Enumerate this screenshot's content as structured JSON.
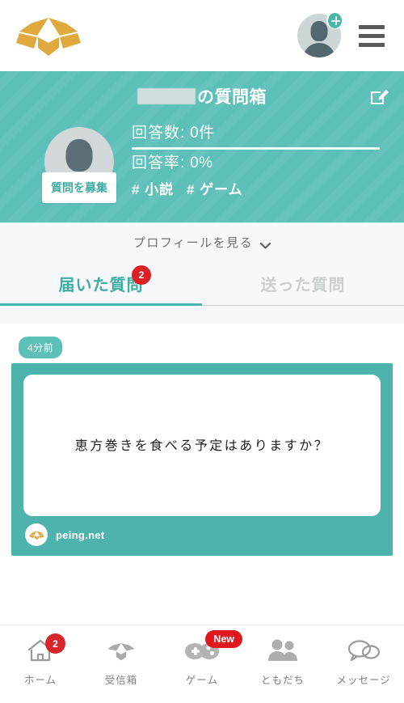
{
  "header": {
    "logo_icon": "open-box-logo",
    "avatar_icon": "user-avatar",
    "avatar_badge_icon": "plus-badge-icon",
    "menu_icon": "hamburger-menu-icon",
    "brand_color": "#e0a93e"
  },
  "banner": {
    "title_redacted": "",
    "title_suffix": "の質問箱",
    "edit_icon": "compose-edit-icon",
    "profile_avatar_icon": "profile-avatar",
    "collect_button_label": "質問を募集",
    "answer_count_label": "回答数:",
    "answer_count_value": "0件",
    "answer_rate_label": "回答率:",
    "answer_rate_value": "0%",
    "tags": [
      "# 小説",
      "# ゲーム"
    ],
    "background_color": "#5cbfb8"
  },
  "profile_link": {
    "label": "プロフィールを見る",
    "chevron_icon": "chevron-down-icon"
  },
  "tabs": [
    {
      "label": "届いた質問",
      "active": true,
      "badge": "2"
    },
    {
      "label": "送った質問",
      "active": false,
      "badge": ""
    }
  ],
  "question_card": {
    "time_label": "4分前",
    "text": "恵方巻きを食べる予定はありますか？",
    "footer_logo_icon": "peing-box-icon",
    "footer_url": "peing.net",
    "card_color": "#4eb3ac"
  },
  "bottom_nav": [
    {
      "label": "ホーム",
      "icon": "home-icon",
      "badge_num": "2",
      "badge_new": ""
    },
    {
      "label": "受信箱",
      "icon": "inbox-box-icon",
      "badge_num": "",
      "badge_new": ""
    },
    {
      "label": "ゲーム",
      "icon": "gamepad-icon",
      "badge_num": "",
      "badge_new": "New"
    },
    {
      "label": "ともだち",
      "icon": "friends-icon",
      "badge_num": "",
      "badge_new": ""
    },
    {
      "label": "メッセージ",
      "icon": "message-bubbles-icon",
      "badge_num": "",
      "badge_new": ""
    }
  ]
}
